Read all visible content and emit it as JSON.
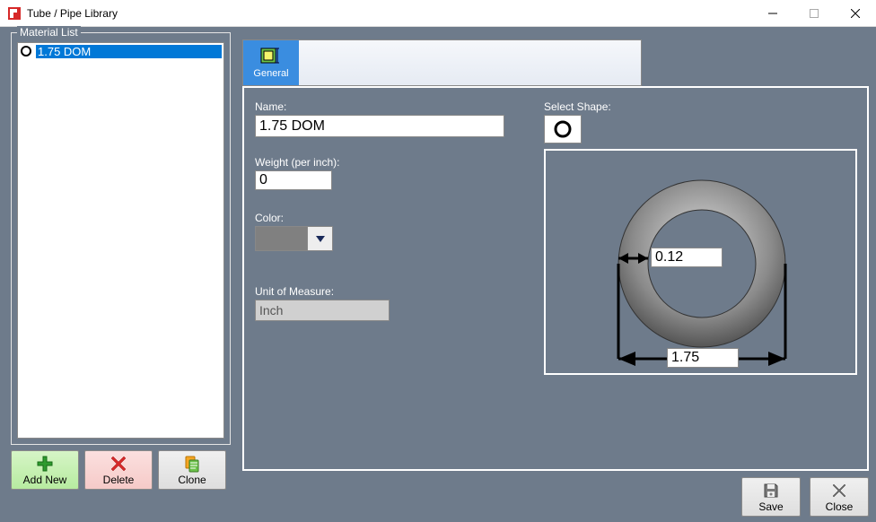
{
  "window": {
    "title": "Tube / Pipe Library"
  },
  "materialList": {
    "legend": "Material List",
    "items": [
      {
        "label": "1.75 DOM",
        "selected": true,
        "shape": "round"
      }
    ]
  },
  "listTools": {
    "addNew": "Add New",
    "delete": "Delete",
    "clone": "Clone"
  },
  "tabs": {
    "general": "General"
  },
  "form": {
    "nameLabel": "Name:",
    "nameValue": "1.75 DOM",
    "weightLabel": "Weight (per inch):",
    "weightValue": "0",
    "colorLabel": "Color:",
    "colorValue": "#808080",
    "unitLabel": "Unit of Measure:",
    "unitValue": "Inch",
    "shapeLabel": "Select Shape:"
  },
  "preview": {
    "wallThickness": "0.12",
    "outerDiameter": "1.75"
  },
  "footer": {
    "save": "Save",
    "close": "Close"
  }
}
